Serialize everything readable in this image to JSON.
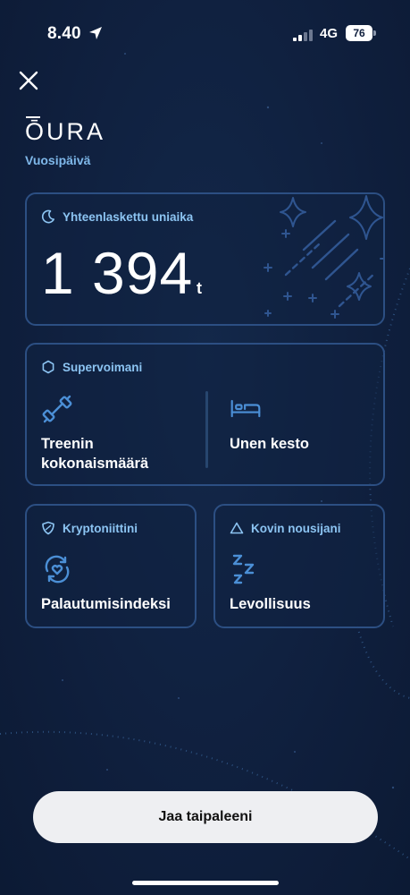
{
  "status_bar": {
    "time": "8.40",
    "network": "4G",
    "battery": "76"
  },
  "brand": {
    "logo_text": "ŌURA",
    "subtitle": "Vuosipäivä"
  },
  "sleep_card": {
    "title": "Yhteenlaskettu uniaika",
    "value": "1 394",
    "unit": "t",
    "icon": "moon-icon"
  },
  "superpowers_card": {
    "title": "Supervoimani",
    "icon": "hexagon-icon",
    "items": [
      {
        "label": "Treenin kokonaismäärä",
        "icon": "dumbbell-icon"
      },
      {
        "label": "Unen kesto",
        "icon": "bed-icon"
      }
    ]
  },
  "kryptonite_card": {
    "title": "Kryptoniittini",
    "icon": "shield-icon",
    "item_label": "Palautumisindeksi",
    "item_icon": "heart-cycle-icon"
  },
  "riser_card": {
    "title": "Kovin nousijani",
    "icon": "triangle-icon",
    "item_label": "Levollisuus",
    "item_icon": "zzz-icon"
  },
  "share_button": {
    "label": "Jaa taipaleeni"
  },
  "colors": {
    "background": "#0f1f3d",
    "card_border": "#2c4f83",
    "accent": "#7fb8ea",
    "icon_blue": "#4b8fd6"
  }
}
